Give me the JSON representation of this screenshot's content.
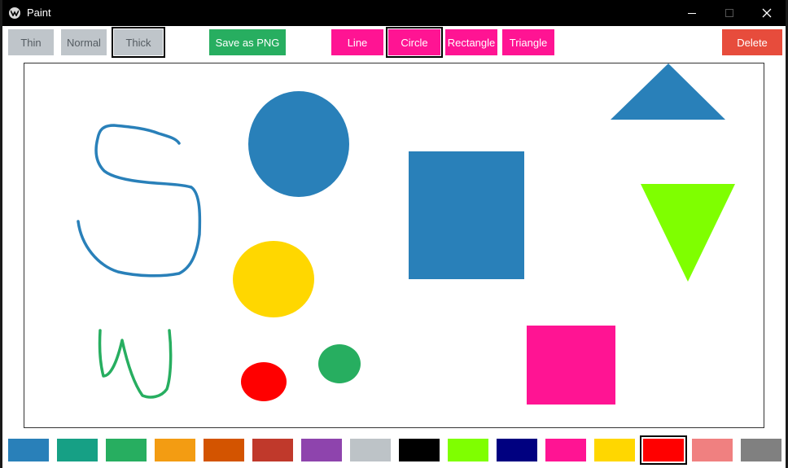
{
  "window": {
    "title": "Paint"
  },
  "toolbar": {
    "thin_label": "Thin",
    "normal_label": "Normal",
    "thick_label": "Thick",
    "save_label": "Save as PNG",
    "line_label": "Line",
    "circle_label": "Circle",
    "rectangle_label": "Rectangle",
    "triangle_label": "Triangle",
    "delete_label": "Delete",
    "selected_thickness": "Thick",
    "selected_tool": "Circle"
  },
  "canvas": {
    "shapes": [
      {
        "kind": "freehand-stroke",
        "color": "#2980b9"
      },
      {
        "kind": "ellipse",
        "color": "#2980b9"
      },
      {
        "kind": "rectangle",
        "color": "#2980b9"
      },
      {
        "kind": "triangle",
        "color": "#2980b9"
      },
      {
        "kind": "inverted-triangle",
        "color": "#7fff00"
      },
      {
        "kind": "ellipse",
        "color": "#ffd700"
      },
      {
        "kind": "freehand-stroke",
        "color": "#27ae60"
      },
      {
        "kind": "ellipse",
        "color": "#ff0000"
      },
      {
        "kind": "ellipse",
        "color": "#27ae60"
      },
      {
        "kind": "rectangle",
        "color": "#ff1493"
      }
    ]
  },
  "palette": {
    "colors": [
      "#2980b9",
      "#16a085",
      "#27ae60",
      "#f39c12",
      "#d35400",
      "#c0392b",
      "#8e44ad",
      "#bdc3c7",
      "#000000",
      "#7fff00",
      "#000080",
      "#ff1493",
      "#ffd700",
      "#ff0000",
      "#f08080",
      "#808080"
    ],
    "selected_index": 13
  }
}
